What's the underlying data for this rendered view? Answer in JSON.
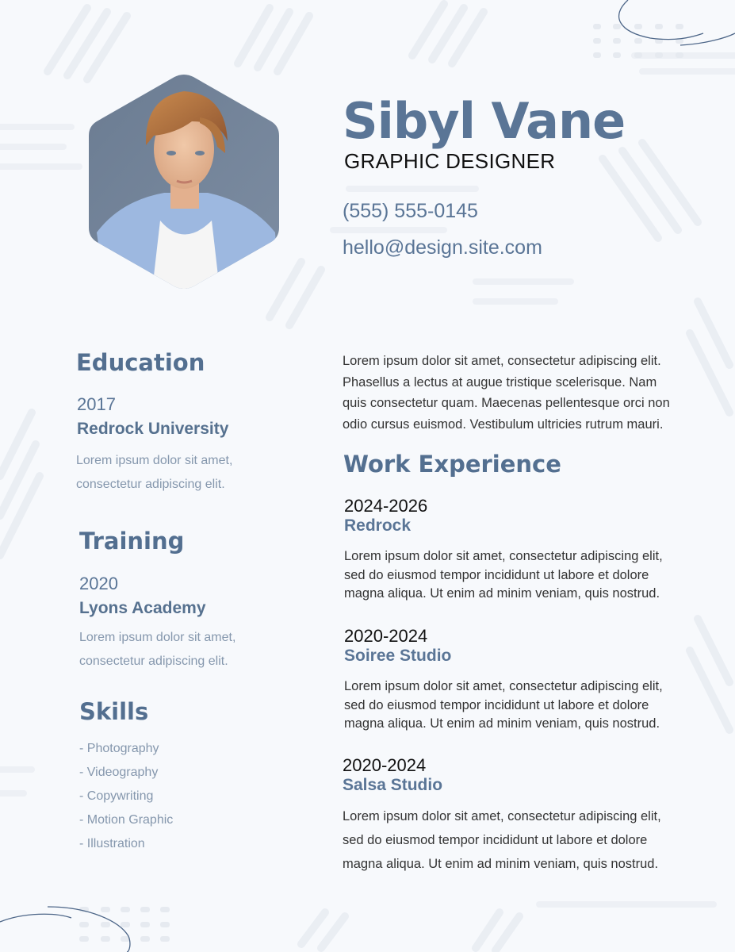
{
  "header": {
    "name": "Sibyl Vane",
    "title": "GRAPHIC DESIGNER",
    "phone": "(555) 555-0145",
    "email": "hello@design.site.com"
  },
  "photo": {
    "alt": "Portrait photo of woman with short auburn hair in blue shirt"
  },
  "education": {
    "heading": "Education",
    "year": "2017",
    "institution": "Redrock University",
    "description_lines": [
      "Lorem ipsum dolor sit amet,",
      "consectetur adipiscing elit."
    ]
  },
  "training": {
    "heading": "Training",
    "year": "2020",
    "institution": "Lyons Academy",
    "description_lines": [
      "Lorem ipsum dolor sit amet,",
      "consectetur adipiscing elit."
    ]
  },
  "skills": {
    "heading": "Skills",
    "items": [
      "- Photography",
      "- Videography",
      "- Copywriting",
      "- Motion Graphic",
      "- Illustration"
    ]
  },
  "intro": {
    "lines": [
      "Lorem ipsum dolor sit amet, consectetur adipiscing elit.",
      "Phasellus a lectus at augue tristique scelerisque. Nam",
      "quis consectetur quam. Maecenas pellentesque orci non",
      "odio cursus euismod. Vestibulum ultricies rutrum mauri."
    ]
  },
  "work": {
    "heading": "Work Experience",
    "jobs": [
      {
        "years": "2024-2026",
        "company": "Redrock",
        "lines": [
          "Lorem ipsum dolor sit amet, consectetur adipiscing elit,",
          "sed do eiusmod tempor incididunt ut labore et dolore",
          "magna aliqua. Ut enim ad minim veniam, quis nostrud."
        ]
      },
      {
        "years": "2020-2024",
        "company": "Soiree Studio",
        "lines": [
          "Lorem ipsum dolor sit amet, consectetur adipiscing elit,",
          "sed do eiusmod tempor incididunt ut labore et dolore",
          "magna aliqua. Ut enim ad minim veniam, quis nostrud."
        ]
      },
      {
        "years": "2020-2024",
        "company": "Salsa Studio",
        "lines": [
          "Lorem ipsum dolor sit amet, consectetur adipiscing elit,",
          "sed do eiusmod tempor incididunt ut labore et dolore",
          "magna aliqua. Ut enim ad minim veniam, quis nostrud."
        ]
      }
    ]
  },
  "colors": {
    "accent": "#5a7596",
    "background": "#f7f9fc",
    "text": "#333333",
    "muted": "#8597ad"
  }
}
